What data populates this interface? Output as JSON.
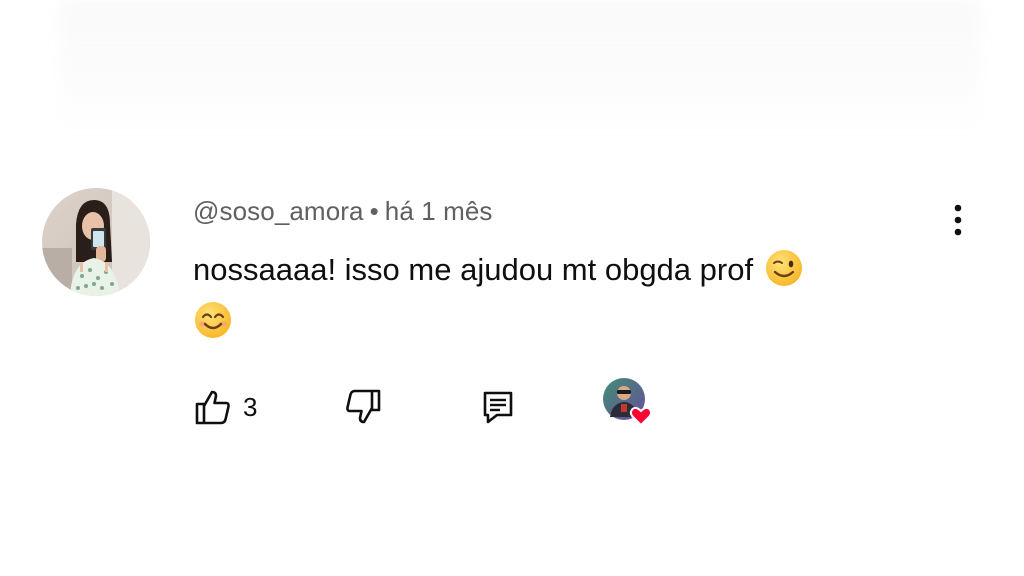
{
  "comment": {
    "author": "@soso_amora",
    "separator": "•",
    "timestamp": "há 1 mês",
    "text": "nossaaaa! isso me ajudou mt obgda prof",
    "emojis": [
      "winking-face",
      "smiling-face-with-smiling-eyes"
    ]
  },
  "actions": {
    "like_count": "3",
    "like_icon": "thumbs-up-icon",
    "dislike_icon": "thumbs-down-icon",
    "reply_icon": "reply-comment-icon",
    "creator_heart": "creator-heart-badge"
  },
  "menu": {
    "icon": "vertical-ellipsis-icon"
  },
  "colors": {
    "text_primary": "#0f0f0f",
    "text_secondary": "#606060",
    "heart": "#ff0033",
    "background": "#ffffff"
  }
}
